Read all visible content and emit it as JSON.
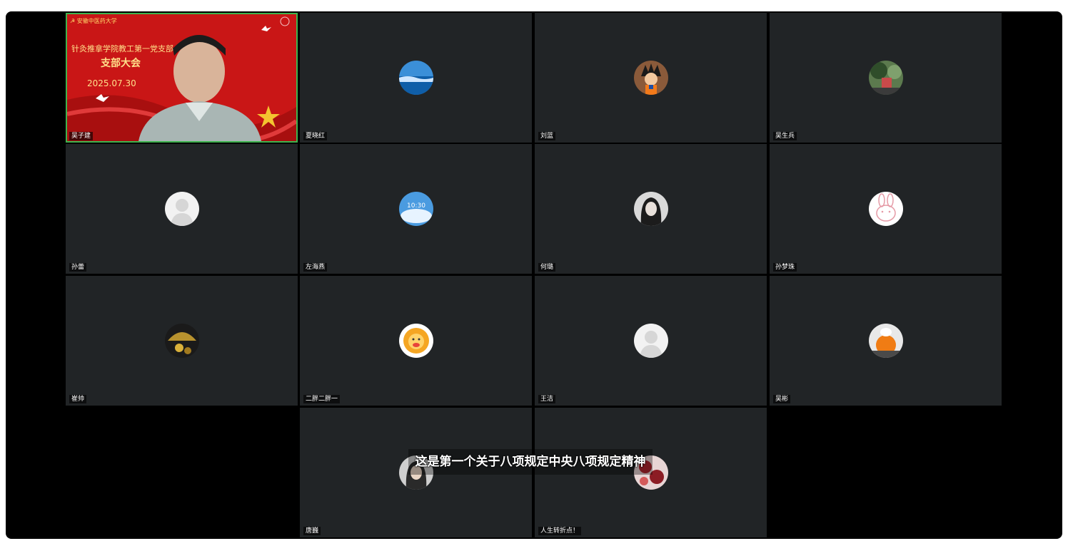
{
  "meeting": {
    "participants": [
      {
        "name": "吴子建",
        "type": "video"
      },
      {
        "name": "夏晓红",
        "avatar": "sea-avatar"
      },
      {
        "name": "刘蓝",
        "avatar": "cartoon-boy-avatar"
      },
      {
        "name": "吴生兵",
        "avatar": "tree-photo-avatar"
      },
      {
        "name": "孙蕾",
        "avatar": "default-person-avatar"
      },
      {
        "name": "左海燕",
        "avatar": "sky-clock-avatar"
      },
      {
        "name": "何璐",
        "avatar": "woman-bw-photo-avatar"
      },
      {
        "name": "孙梦珠",
        "avatar": "bunny-sketch-avatar"
      },
      {
        "name": "崔帅",
        "avatar": "golden-umbrella-avatar"
      },
      {
        "name": "二胖二胖一",
        "avatar": "lion-cartoon-avatar"
      },
      {
        "name": "王洁",
        "avatar": "default-person-avatar"
      },
      {
        "name": "吴彬",
        "avatar": "orange-pumpkin-avatar"
      },
      {
        "name": "唐巍",
        "avatar": "woman-photo-avatar"
      },
      {
        "name": "人生转折点！",
        "avatar": "red-floral-avatar"
      }
    ],
    "video_background": {
      "logo_text": "安徽中医药大学",
      "line1": "针灸推拿学院教工第一党支部",
      "line2": "支部大会",
      "date": "2025.07.30"
    },
    "live_subtitle": "这是第一个关于八项规定中央八项规定精神",
    "colors": {
      "tile_bg": "#212426",
      "active_border": "#3fb34f",
      "banner_red": "#c71515"
    }
  }
}
